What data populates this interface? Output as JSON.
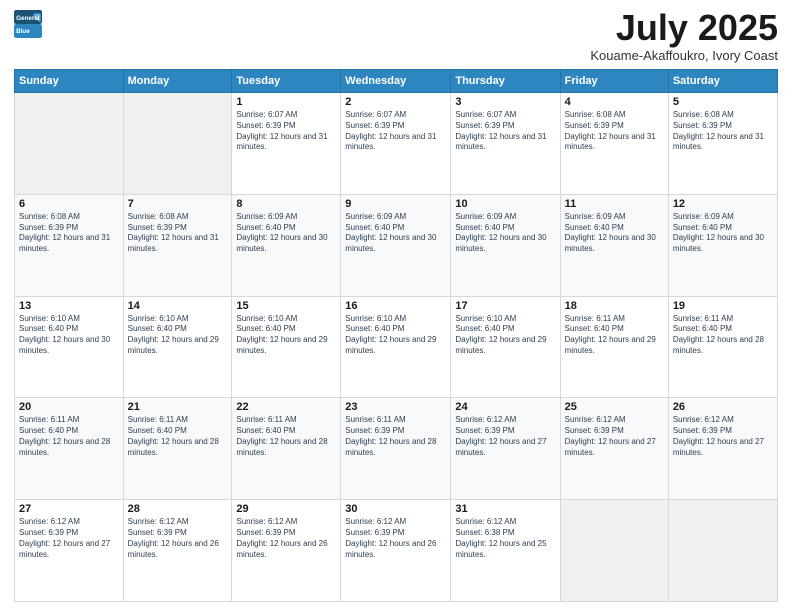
{
  "logo": {
    "line1": "General",
    "line2": "Blue"
  },
  "header": {
    "month": "July 2025",
    "location": "Kouame-Akaffoukro, Ivory Coast"
  },
  "weekdays": [
    "Sunday",
    "Monday",
    "Tuesday",
    "Wednesday",
    "Thursday",
    "Friday",
    "Saturday"
  ],
  "weeks": [
    [
      {
        "day": "",
        "info": ""
      },
      {
        "day": "",
        "info": ""
      },
      {
        "day": "1",
        "info": "Sunrise: 6:07 AM\nSunset: 6:39 PM\nDaylight: 12 hours and 31 minutes."
      },
      {
        "day": "2",
        "info": "Sunrise: 6:07 AM\nSunset: 6:39 PM\nDaylight: 12 hours and 31 minutes."
      },
      {
        "day": "3",
        "info": "Sunrise: 6:07 AM\nSunset: 6:39 PM\nDaylight: 12 hours and 31 minutes."
      },
      {
        "day": "4",
        "info": "Sunrise: 6:08 AM\nSunset: 6:39 PM\nDaylight: 12 hours and 31 minutes."
      },
      {
        "day": "5",
        "info": "Sunrise: 6:08 AM\nSunset: 6:39 PM\nDaylight: 12 hours and 31 minutes."
      }
    ],
    [
      {
        "day": "6",
        "info": "Sunrise: 6:08 AM\nSunset: 6:39 PM\nDaylight: 12 hours and 31 minutes."
      },
      {
        "day": "7",
        "info": "Sunrise: 6:08 AM\nSunset: 6:39 PM\nDaylight: 12 hours and 31 minutes."
      },
      {
        "day": "8",
        "info": "Sunrise: 6:09 AM\nSunset: 6:40 PM\nDaylight: 12 hours and 30 minutes."
      },
      {
        "day": "9",
        "info": "Sunrise: 6:09 AM\nSunset: 6:40 PM\nDaylight: 12 hours and 30 minutes."
      },
      {
        "day": "10",
        "info": "Sunrise: 6:09 AM\nSunset: 6:40 PM\nDaylight: 12 hours and 30 minutes."
      },
      {
        "day": "11",
        "info": "Sunrise: 6:09 AM\nSunset: 6:40 PM\nDaylight: 12 hours and 30 minutes."
      },
      {
        "day": "12",
        "info": "Sunrise: 6:09 AM\nSunset: 6:40 PM\nDaylight: 12 hours and 30 minutes."
      }
    ],
    [
      {
        "day": "13",
        "info": "Sunrise: 6:10 AM\nSunset: 6:40 PM\nDaylight: 12 hours and 30 minutes."
      },
      {
        "day": "14",
        "info": "Sunrise: 6:10 AM\nSunset: 6:40 PM\nDaylight: 12 hours and 29 minutes."
      },
      {
        "day": "15",
        "info": "Sunrise: 6:10 AM\nSunset: 6:40 PM\nDaylight: 12 hours and 29 minutes."
      },
      {
        "day": "16",
        "info": "Sunrise: 6:10 AM\nSunset: 6:40 PM\nDaylight: 12 hours and 29 minutes."
      },
      {
        "day": "17",
        "info": "Sunrise: 6:10 AM\nSunset: 6:40 PM\nDaylight: 12 hours and 29 minutes."
      },
      {
        "day": "18",
        "info": "Sunrise: 6:11 AM\nSunset: 6:40 PM\nDaylight: 12 hours and 29 minutes."
      },
      {
        "day": "19",
        "info": "Sunrise: 6:11 AM\nSunset: 6:40 PM\nDaylight: 12 hours and 28 minutes."
      }
    ],
    [
      {
        "day": "20",
        "info": "Sunrise: 6:11 AM\nSunset: 6:40 PM\nDaylight: 12 hours and 28 minutes."
      },
      {
        "day": "21",
        "info": "Sunrise: 6:11 AM\nSunset: 6:40 PM\nDaylight: 12 hours and 28 minutes."
      },
      {
        "day": "22",
        "info": "Sunrise: 6:11 AM\nSunset: 6:40 PM\nDaylight: 12 hours and 28 minutes."
      },
      {
        "day": "23",
        "info": "Sunrise: 6:11 AM\nSunset: 6:39 PM\nDaylight: 12 hours and 28 minutes."
      },
      {
        "day": "24",
        "info": "Sunrise: 6:12 AM\nSunset: 6:39 PM\nDaylight: 12 hours and 27 minutes."
      },
      {
        "day": "25",
        "info": "Sunrise: 6:12 AM\nSunset: 6:39 PM\nDaylight: 12 hours and 27 minutes."
      },
      {
        "day": "26",
        "info": "Sunrise: 6:12 AM\nSunset: 6:39 PM\nDaylight: 12 hours and 27 minutes."
      }
    ],
    [
      {
        "day": "27",
        "info": "Sunrise: 6:12 AM\nSunset: 6:39 PM\nDaylight: 12 hours and 27 minutes."
      },
      {
        "day": "28",
        "info": "Sunrise: 6:12 AM\nSunset: 6:39 PM\nDaylight: 12 hours and 26 minutes."
      },
      {
        "day": "29",
        "info": "Sunrise: 6:12 AM\nSunset: 6:39 PM\nDaylight: 12 hours and 26 minutes."
      },
      {
        "day": "30",
        "info": "Sunrise: 6:12 AM\nSunset: 6:39 PM\nDaylight: 12 hours and 26 minutes."
      },
      {
        "day": "31",
        "info": "Sunrise: 6:12 AM\nSunset: 6:38 PM\nDaylight: 12 hours and 25 minutes."
      },
      {
        "day": "",
        "info": ""
      },
      {
        "day": "",
        "info": ""
      }
    ]
  ]
}
